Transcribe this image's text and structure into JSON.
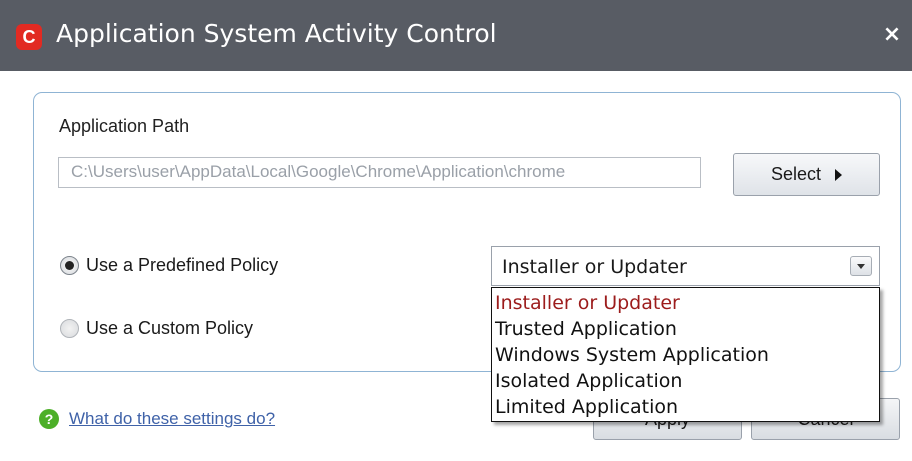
{
  "window": {
    "title": "Application System Activity Control",
    "logo_letter": "C",
    "close_glyph": "×"
  },
  "application_path": {
    "label": "Application Path",
    "value": "C:\\Users\\user\\AppData\\Local\\Google\\Chrome\\Application\\chrome",
    "select_button_label": "Select"
  },
  "policy": {
    "predefined_label": "Use a Predefined Policy",
    "custom_label": "Use a Custom Policy",
    "selected_mode": "predefined",
    "selected_value": "Installer or Updater",
    "options": [
      "Installer or Updater",
      "Trusted Application",
      "Windows System Application",
      "Isolated Application",
      "Limited Application"
    ]
  },
  "footer": {
    "help_icon_glyph": "?",
    "help_link": "What do these settings do?",
    "apply_label": "Apply",
    "cancel_label": "Cancel"
  },
  "colors": {
    "titlebar": "#585c64",
    "logo": "#e22a22",
    "group_border": "#8fb4d4",
    "help_icon": "#4caf28",
    "link": "#3f62a8",
    "highlight_option": "#9c1c1c"
  },
  "icons": {
    "logo": "comodo-logo-icon",
    "close": "close-icon",
    "select_arrow": "chevron-right-icon",
    "dropdown_arrow": "chevron-down-icon",
    "help": "help-icon"
  }
}
